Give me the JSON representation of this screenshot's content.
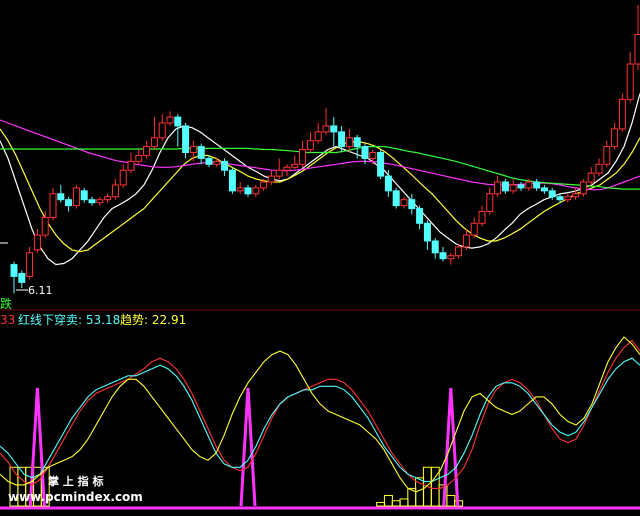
{
  "chart_data": [
    {
      "type": "candlestick",
      "panel": "price",
      "up_color": "#ff3333",
      "down_color": "#54ffff",
      "low_marker_text": "6.11",
      "side_label": "跌",
      "ma_lines": [
        {
          "name": "MA-white",
          "color": "#ffffff",
          "values": [
            8.7,
            8.4,
            8.0,
            7.6,
            7.2,
            6.9,
            6.7,
            6.6,
            6.62,
            6.7,
            6.85,
            7.0,
            7.2,
            7.4,
            7.55,
            7.62,
            7.7,
            7.8,
            7.95,
            8.2,
            8.5,
            8.75,
            8.9,
            8.95,
            8.92,
            8.85,
            8.75,
            8.65,
            8.55,
            8.45,
            8.35,
            8.25,
            8.18,
            8.1,
            8.05,
            8.02,
            8.05,
            8.15,
            8.25,
            8.35,
            8.45,
            8.55,
            8.6,
            8.55,
            8.5,
            8.45,
            8.4,
            8.3,
            8.2,
            8.05,
            7.9,
            7.75,
            7.6,
            7.45,
            7.3,
            7.15,
            7.05,
            6.95,
            6.9,
            6.88,
            6.9,
            6.95,
            7.05,
            7.18,
            7.3,
            7.45,
            7.55,
            7.62,
            7.7,
            7.75,
            7.8,
            7.82,
            7.85,
            7.9,
            7.95,
            8.05,
            8.15,
            8.35,
            8.6,
            9.0,
            9.5
          ]
        },
        {
          "name": "MA-yellow",
          "color": "#ffff33",
          "values": [
            8.9,
            8.7,
            8.45,
            8.15,
            7.85,
            7.55,
            7.3,
            7.1,
            6.95,
            6.85,
            6.82,
            6.85,
            6.95,
            7.05,
            7.15,
            7.25,
            7.35,
            7.45,
            7.55,
            7.7,
            7.85,
            8.0,
            8.15,
            8.3,
            8.4,
            8.45,
            8.45,
            8.4,
            8.32,
            8.25,
            8.18,
            8.1,
            8.05,
            8.02,
            8.0,
            8.0,
            8.05,
            8.12,
            8.2,
            8.3,
            8.4,
            8.5,
            8.58,
            8.65,
            8.68,
            8.68,
            8.65,
            8.6,
            8.52,
            8.42,
            8.3,
            8.18,
            8.05,
            7.92,
            7.8,
            7.65,
            7.5,
            7.35,
            7.22,
            7.12,
            7.05,
            7.0,
            7.0,
            7.05,
            7.12,
            7.2,
            7.3,
            7.4,
            7.5,
            7.58,
            7.65,
            7.72,
            7.8,
            7.85,
            7.9,
            7.95,
            8.05,
            8.15,
            8.3,
            8.5,
            8.75
          ]
        },
        {
          "name": "MA-magenta",
          "color": "#ff33ff",
          "values": [
            9.05,
            9.0,
            8.95,
            8.9,
            8.85,
            8.8,
            8.75,
            8.7,
            8.65,
            8.6,
            8.55,
            8.5,
            8.46,
            8.42,
            8.38,
            8.35,
            8.33,
            8.3,
            8.28,
            8.26,
            8.25,
            8.25,
            8.26,
            8.28,
            8.3,
            8.32,
            8.33,
            8.33,
            8.32,
            8.3,
            8.28,
            8.26,
            8.24,
            8.22,
            8.2,
            8.19,
            8.19,
            8.2,
            8.22,
            8.24,
            8.26,
            8.28,
            8.3,
            8.32,
            8.34,
            8.35,
            8.35,
            8.34,
            8.32,
            8.3,
            8.27,
            8.24,
            8.21,
            8.18,
            8.15,
            8.12,
            8.09,
            8.06,
            8.03,
            8.0,
            7.98,
            7.96,
            7.95,
            7.95,
            7.95,
            7.96,
            7.97,
            7.98,
            7.98,
            7.97,
            7.95,
            7.92,
            7.9,
            7.88,
            7.87,
            7.87,
            7.9,
            7.95,
            8.0,
            8.05,
            8.1
          ]
        },
        {
          "name": "MA-green",
          "color": "#33ff33",
          "values": [
            8.56,
            8.56,
            8.56,
            8.56,
            8.56,
            8.56,
            8.56,
            8.56,
            8.56,
            8.56,
            8.56,
            8.56,
            8.56,
            8.56,
            8.56,
            8.56,
            8.56,
            8.56,
            8.56,
            8.56,
            8.56,
            8.56,
            8.56,
            8.57,
            8.57,
            8.57,
            8.57,
            8.57,
            8.57,
            8.57,
            8.57,
            8.57,
            8.56,
            8.55,
            8.55,
            8.54,
            8.53,
            8.52,
            8.5,
            8.5,
            8.5,
            8.5,
            8.5,
            8.52,
            8.55,
            8.58,
            8.6,
            8.6,
            8.6,
            8.58,
            8.55,
            8.52,
            8.5,
            8.47,
            8.44,
            8.41,
            8.38,
            8.35,
            8.31,
            8.27,
            8.23,
            8.19,
            8.15,
            8.11,
            8.07,
            8.04,
            8.02,
            8.0,
            7.99,
            7.98,
            7.97,
            7.96,
            7.95,
            7.94,
            7.93,
            7.92,
            7.9,
            7.89,
            7.88,
            7.88,
            7.88
          ]
        }
      ],
      "candles": [
        [
          6.6,
          6.4,
          6.65,
          6.11
        ],
        [
          6.45,
          6.3,
          6.5,
          6.2
        ],
        [
          6.4,
          6.8,
          6.9,
          6.35
        ],
        [
          6.85,
          7.1,
          7.2,
          6.8
        ],
        [
          7.1,
          7.4,
          7.5,
          7.05
        ],
        [
          7.4,
          7.8,
          7.9,
          7.35
        ],
        [
          7.8,
          7.7,
          7.95,
          7.65
        ],
        [
          7.7,
          7.6,
          7.75,
          7.5
        ],
        [
          7.6,
          7.9,
          7.95,
          7.55
        ],
        [
          7.85,
          7.7,
          7.9,
          7.65
        ],
        [
          7.7,
          7.65,
          7.75,
          7.6
        ],
        [
          7.65,
          7.7,
          7.75,
          7.6
        ],
        [
          7.7,
          7.75,
          7.8,
          7.65
        ],
        [
          7.75,
          7.95,
          8.05,
          7.7
        ],
        [
          7.95,
          8.2,
          8.3,
          7.9
        ],
        [
          8.2,
          8.35,
          8.5,
          8.15
        ],
        [
          8.35,
          8.45,
          8.55,
          8.3
        ],
        [
          8.45,
          8.6,
          8.7,
          8.4
        ],
        [
          8.6,
          8.75,
          9.1,
          8.55
        ],
        [
          8.75,
          9.0,
          9.15,
          8.7
        ],
        [
          9.0,
          9.1,
          9.2,
          8.95
        ],
        [
          9.1,
          8.95,
          9.15,
          8.6
        ],
        [
          8.95,
          8.5,
          9.0,
          8.4
        ],
        [
          8.5,
          8.6,
          8.7,
          8.35
        ],
        [
          8.6,
          8.4,
          8.65,
          8.3
        ],
        [
          8.4,
          8.3,
          8.45,
          8.25
        ],
        [
          8.3,
          8.35,
          8.4,
          8.25
        ],
        [
          8.35,
          8.2,
          8.4,
          8.1
        ],
        [
          8.2,
          7.85,
          8.25,
          7.8
        ],
        [
          7.85,
          7.9,
          8.0,
          7.8
        ],
        [
          7.9,
          7.8,
          7.95,
          7.75
        ],
        [
          7.8,
          7.9,
          7.95,
          7.75
        ],
        [
          7.9,
          8.0,
          8.05,
          7.85
        ],
        [
          8.0,
          8.1,
          8.2,
          7.95
        ],
        [
          8.1,
          8.2,
          8.4,
          8.05
        ],
        [
          8.2,
          8.25,
          8.3,
          8.1
        ],
        [
          8.25,
          8.3,
          8.45,
          8.2
        ],
        [
          8.3,
          8.55,
          8.7,
          8.25
        ],
        [
          8.55,
          8.7,
          8.85,
          8.5
        ],
        [
          8.7,
          8.85,
          9.0,
          8.65
        ],
        [
          8.85,
          8.95,
          9.25,
          8.8
        ],
        [
          8.95,
          8.85,
          9.1,
          8.6
        ],
        [
          8.85,
          8.6,
          8.95,
          8.5
        ],
        [
          8.6,
          8.75,
          8.9,
          8.5
        ],
        [
          8.75,
          8.6,
          8.8,
          8.4
        ],
        [
          8.6,
          8.4,
          8.65,
          8.3
        ],
        [
          8.4,
          8.5,
          8.55,
          8.3
        ],
        [
          8.5,
          8.1,
          8.55,
          8.05
        ],
        [
          8.1,
          7.85,
          8.2,
          7.75
        ],
        [
          7.85,
          7.6,
          7.9,
          7.55
        ],
        [
          7.6,
          7.7,
          7.75,
          7.55
        ],
        [
          7.7,
          7.55,
          7.8,
          7.45
        ],
        [
          7.55,
          7.3,
          7.6,
          7.2
        ],
        [
          7.3,
          7.0,
          7.35,
          6.85
        ],
        [
          7.0,
          6.8,
          7.05,
          6.7
        ],
        [
          6.8,
          6.7,
          6.9,
          6.65
        ],
        [
          6.7,
          6.75,
          6.8,
          6.6
        ],
        [
          6.75,
          6.9,
          6.95,
          6.7
        ],
        [
          6.9,
          7.1,
          7.2,
          6.85
        ],
        [
          7.1,
          7.3,
          7.4,
          7.05
        ],
        [
          7.3,
          7.5,
          7.6,
          7.25
        ],
        [
          7.5,
          7.8,
          7.9,
          7.45
        ],
        [
          7.8,
          8.0,
          8.1,
          7.75
        ],
        [
          8.0,
          7.85,
          8.05,
          7.8
        ],
        [
          7.85,
          7.95,
          8.05,
          7.8
        ],
        [
          7.95,
          7.9,
          8.0,
          7.85
        ],
        [
          7.9,
          8.0,
          8.05,
          7.85
        ],
        [
          8.0,
          7.9,
          8.05,
          7.85
        ],
        [
          7.9,
          7.85,
          7.95,
          7.8
        ],
        [
          7.85,
          7.75,
          7.9,
          7.7
        ],
        [
          7.75,
          7.7,
          7.8,
          7.65
        ],
        [
          7.7,
          7.75,
          7.8,
          7.65
        ],
        [
          7.75,
          7.8,
          7.9,
          7.7
        ],
        [
          7.8,
          8.0,
          8.05,
          7.75
        ],
        [
          8.0,
          8.15,
          8.25,
          7.95
        ],
        [
          8.15,
          8.3,
          8.4,
          8.1
        ],
        [
          8.3,
          8.6,
          8.7,
          8.25
        ],
        [
          8.6,
          8.9,
          9.0,
          8.55
        ],
        [
          8.9,
          9.4,
          9.5,
          8.85
        ],
        [
          9.4,
          10.0,
          10.2,
          9.35
        ],
        [
          10.0,
          10.5,
          11.0,
          9.9
        ]
      ]
    },
    {
      "type": "line",
      "panel": "indicator",
      "legend_items": [
        {
          "text": "33",
          "color": "#ff3333"
        },
        {
          "text": "红线下穿卖: 53.18",
          "color": "#54ffff"
        },
        {
          "text": "趋势: 22.91",
          "color": "#ffff33"
        }
      ],
      "ylim": [
        0,
        100
      ],
      "series": [
        {
          "color": "#ff3333",
          "values": [
            30,
            25,
            18,
            14,
            12,
            15,
            22,
            30,
            38,
            46,
            54,
            60,
            64,
            66,
            68,
            70,
            72,
            75,
            78,
            82,
            84,
            82,
            78,
            72,
            64,
            54,
            44,
            34,
            26,
            22,
            20,
            22,
            30,
            40,
            50,
            58,
            62,
            64,
            66,
            68,
            70,
            72,
            72,
            70,
            66,
            60,
            54,
            46,
            38,
            30,
            24,
            18,
            14,
            12,
            10,
            10,
            12,
            16,
            22,
            32,
            46,
            58,
            66,
            70,
            72,
            70,
            66,
            60,
            52,
            44,
            38,
            36,
            38,
            46,
            56,
            66,
            76,
            84,
            90,
            94,
            88
          ]
        },
        {
          "color": "#54ffff",
          "values": [
            34,
            30,
            24,
            18,
            16,
            18,
            26,
            34,
            42,
            50,
            56,
            62,
            66,
            68,
            70,
            72,
            74,
            74,
            76,
            78,
            80,
            78,
            74,
            68,
            60,
            50,
            40,
            30,
            24,
            22,
            22,
            26,
            34,
            44,
            52,
            58,
            62,
            64,
            66,
            66,
            68,
            68,
            68,
            66,
            62,
            56,
            50,
            42,
            34,
            28,
            22,
            18,
            16,
            14,
            14,
            16,
            18,
            22,
            30,
            40,
            52,
            62,
            68,
            70,
            70,
            68,
            64,
            58,
            52,
            46,
            42,
            40,
            42,
            48,
            56,
            64,
            72,
            78,
            82,
            84,
            80
          ]
        },
        {
          "color": "#ffff33",
          "values": [
            18,
            14,
            12,
            12,
            14,
            18,
            22,
            24,
            26,
            28,
            32,
            38,
            46,
            54,
            62,
            68,
            72,
            72,
            68,
            62,
            56,
            50,
            44,
            38,
            32,
            28,
            26,
            30,
            40,
            52,
            62,
            70,
            76,
            82,
            86,
            88,
            86,
            80,
            72,
            64,
            58,
            54,
            52,
            50,
            48,
            46,
            42,
            38,
            32,
            24,
            16,
            10,
            8,
            10,
            14,
            20,
            30,
            42,
            54,
            62,
            64,
            60,
            56,
            54,
            52,
            54,
            58,
            62,
            62,
            58,
            52,
            48,
            46,
            50,
            58,
            70,
            82,
            90,
            96,
            92,
            86
          ]
        }
      ],
      "bar_color": "#ffff33",
      "bars": [
        {
          "i": 0,
          "v": 22
        },
        {
          "i": 1,
          "v": 22
        },
        {
          "i": 2,
          "v": 22
        },
        {
          "i": 3,
          "v": 22
        },
        {
          "i": 4,
          "v": 22
        },
        {
          "i": 47,
          "v": 2
        },
        {
          "i": 48,
          "v": 6
        },
        {
          "i": 49,
          "v": 3
        },
        {
          "i": 50,
          "v": 4
        },
        {
          "i": 51,
          "v": 10
        },
        {
          "i": 52,
          "v": 16
        },
        {
          "i": 53,
          "v": 22
        },
        {
          "i": 54,
          "v": 22
        },
        {
          "i": 55,
          "v": 12
        },
        {
          "i": 56,
          "v": 6
        },
        {
          "i": 57,
          "v": 3
        }
      ],
      "spike_color": "#ff33ff",
      "spikes": [
        3,
        30,
        56
      ]
    }
  ],
  "watermark": {
    "line1": "掌 上 指 标",
    "line2": "www.pcmindex.com"
  }
}
